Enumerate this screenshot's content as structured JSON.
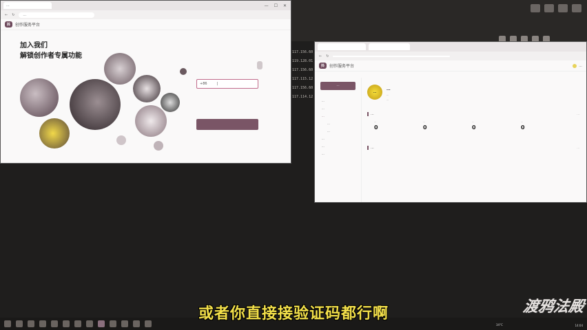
{
  "subtitle": "或者你直接接验证码都行啊",
  "watermark": "渡鸦法殿",
  "background": {
    "list": [
      "117.156.60",
      "119.128.01",
      "117.156.60",
      "117.115.12",
      "117.156.60",
      "117.114.12"
    ]
  },
  "window1": {
    "tab_title": "...",
    "url": "...",
    "logo": "抖",
    "site_name": "创作服务平台",
    "hero_line1": "加入我们",
    "hero_line2": "解锁创作者专属功能"
  },
  "window2": {
    "site_name": "创作服务平台",
    "user_menu": "...",
    "publish_button": "...",
    "sidebar": [
      {
        "label": "...",
        "sub": false
      },
      {
        "label": "...",
        "sub": false
      },
      {
        "label": "...",
        "sub": false
      },
      {
        "label": "...",
        "sub": true
      },
      {
        "label": "...",
        "sub": true
      },
      {
        "label": "...",
        "sub": false
      },
      {
        "label": "...",
        "sub": false
      },
      {
        "label": "...",
        "sub": false
      }
    ],
    "profile": {
      "avatar_text": "...",
      "name": "...",
      "meta": "...",
      "desc": "..."
    },
    "data_section": {
      "title": "...",
      "more": "..."
    },
    "stats": [
      {
        "label": "...",
        "value": "0"
      },
      {
        "label": "...",
        "value": "0"
      },
      {
        "label": "...",
        "value": "0"
      },
      {
        "label": "...",
        "value": "0"
      }
    ],
    "works_section": {
      "title": "...",
      "more": "..."
    }
  },
  "taskbar": {
    "weather": "34°C",
    "time": "14:04"
  }
}
